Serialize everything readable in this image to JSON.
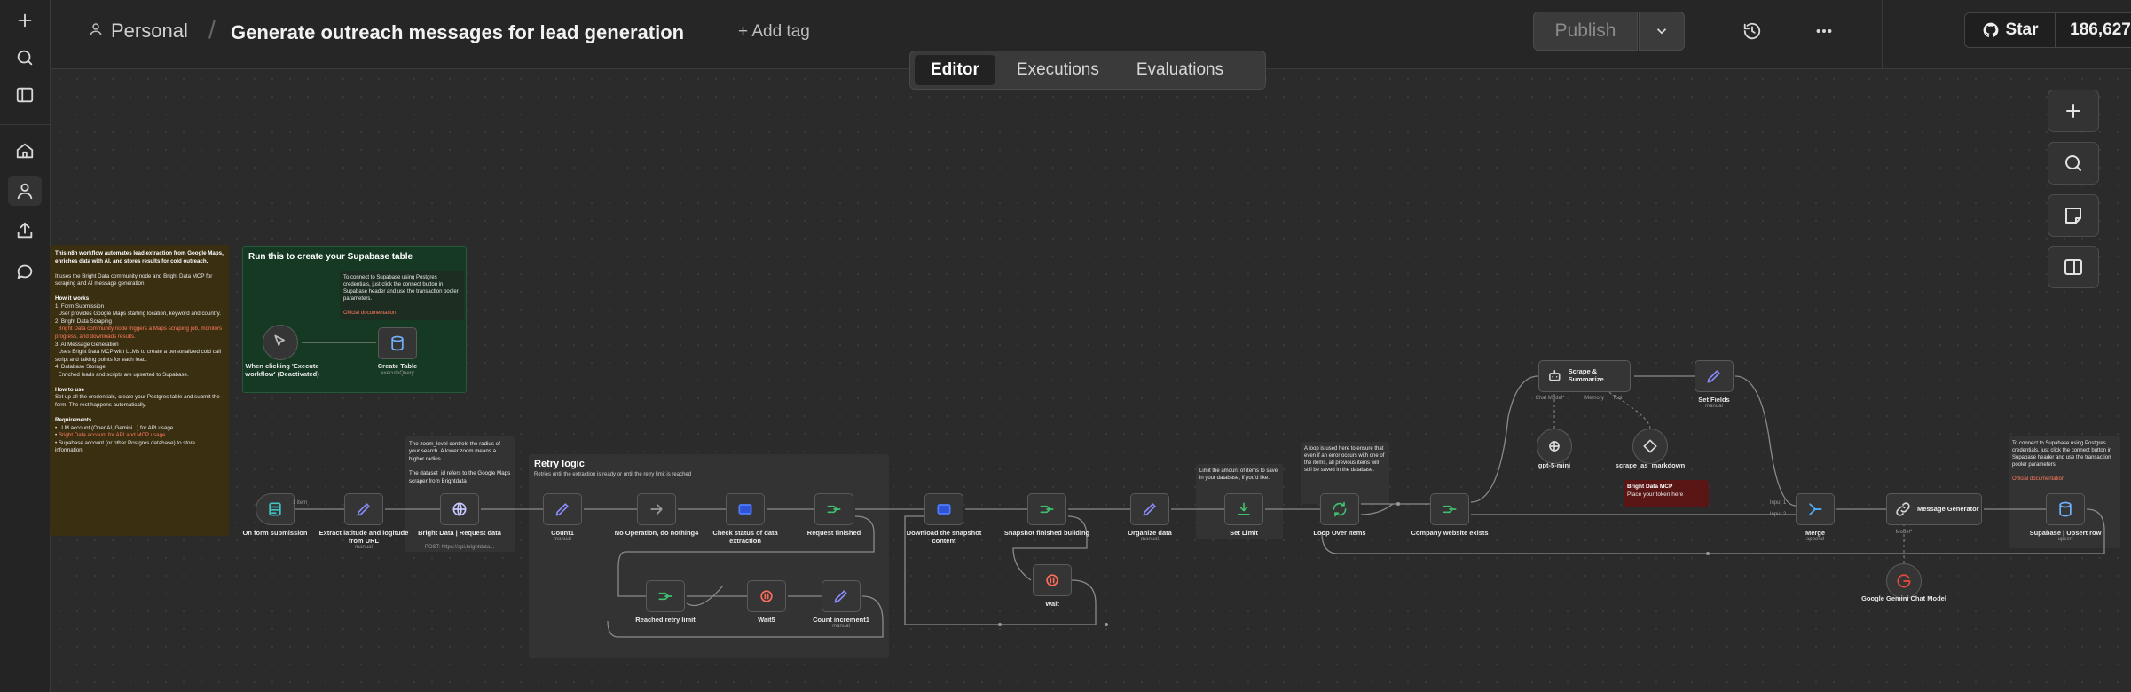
{
  "sidebar": {
    "items": [
      {
        "icon": "plus-icon"
      },
      {
        "icon": "search-icon"
      },
      {
        "icon": "panel-icon"
      },
      {
        "icon": "home-icon"
      },
      {
        "icon": "user-icon"
      },
      {
        "icon": "share-icon"
      },
      {
        "icon": "chat-icon"
      }
    ]
  },
  "header": {
    "project": "Personal",
    "separator": "/",
    "title": "Generate outreach messages for lead generation",
    "add_tag": "+ Add tag",
    "publish": "Publish",
    "star_label": "Star",
    "star_count": "186,627"
  },
  "tabs": [
    {
      "label": "Editor",
      "active": true
    },
    {
      "label": "Executions",
      "active": false
    },
    {
      "label": "Evaluations",
      "active": false
    }
  ],
  "notes": {
    "intro_title": "This n8n workflow automates lead extraction from Google Maps, enriches data with AI, and stores results for cold outreach.",
    "intro_uses": "It uses the Bright Data community node and Bright Data MCP for scraping and AI message generation.",
    "intro_how_head": "How it works",
    "intro_how_1": "1. Form Submission",
    "intro_how_1b": "User provides Google Maps starting location, keyword and country.",
    "intro_how_2": "2. Bright Data Scraping",
    "intro_how_2b": "Bright Data community node triggers a Maps scraping job, monitors progress, and downloads results.",
    "intro_how_3": "3. AI Message Generation",
    "intro_how_3b": "Uses Bright Data MCP with LLMs to create a personalized cold call script and talking points for each lead.",
    "intro_how_4": "4. Database Storage",
    "intro_how_4b": "Enriched leads and scripts are upserted to Supabase.",
    "intro_use_head": "How to use",
    "intro_use": "Set up all the credentials, create your Postgres table and submit the form. The rest happens automatically.",
    "intro_req_head": "Requirements",
    "intro_req_1": "LLM account (OpenAI, Gemini...) for API usage.",
    "intro_req_2": "Bright Data account for API and MCP usage.",
    "intro_req_3": "Supabase account (or other Postgres database) to store information.",
    "supabase_title": "Run this to create your Supabase table",
    "supabase_inner": "To connect to Supabase using Postgres credentials, just click the connect button in Supabase header and use the transaction pooler parameters.",
    "supabase_doc": "Official documentation",
    "radius_a": "The zoom_level controls the radius of your search. A lower zoom means a higher radius.",
    "radius_b": "The dataset_id refers to the Google Maps scraper from Brightdata",
    "retry_title": "Retry logic",
    "retry_sub": "Retries until the extraction is ready or until the retry limit is reached",
    "limit_note": "Limit the amount of items to save in your database, if you'd like.",
    "loop_note": "A loop is used here to ensure that even if an error occurs with one of the items, all previous items will still be saved in the database.",
    "supa2_note": "To connect to Supabase using Postgres credentials, just click the connect button in Supabase header and use the transaction pooler parameters.",
    "supa2_doc": "Official documentation",
    "mcp_title": "Bright Data MCP",
    "mcp_sub": "Place your token here"
  },
  "nodes": {
    "click_trigger": "When clicking 'Execute workflow' (Deactivated)",
    "create_table": "Create Table",
    "create_table_sub": "executeQuery",
    "form": "On form submission",
    "extract": "Extract latitude and logitude from URL",
    "extract_sub": "manual",
    "bright_request": "Bright Data | Request data",
    "bright_request_sub": "POST: https://api.brightdata...",
    "count1": "Count1",
    "count1_sub": "manual",
    "noop": "No Operation, do nothing4",
    "check_status": "Check status of data extraction",
    "request_finished": "Request finished",
    "reached_retry": "Reached retry limit",
    "wait5": "Wait5",
    "count_increment": "Count increment1",
    "count_increment_sub": "manual",
    "download": "Download the snapshot content",
    "snapshot_finished": "Snapshot finished building",
    "wait": "Wait",
    "organize": "Organize data",
    "organize_sub": "manual",
    "set_limit": "Set Limit",
    "loop": "Loop Over Items",
    "company_website": "Company website exists",
    "scrape": "Scrape & Summarize",
    "set_fields": "Set Fields",
    "set_fields_sub": "manual",
    "gpt": "gpt-5-mini",
    "scrape_md": "scrape_as_markdown",
    "merge": "Merge",
    "merge_sub": "append",
    "message_gen": "Message Generator",
    "supabase_upsert": "Supabase | Upsert row",
    "supabase_upsert_sub": "upsert",
    "gemini": "Google Gemini Chat Model",
    "edge_label_1": "1 item",
    "port_chat": "Chat Model*",
    "port_memory": "Memory",
    "port_tool": "Tool",
    "port_input1": "Input 1",
    "port_input2": "Input 2",
    "port_model": "Model*"
  },
  "colors": {
    "accent": "#ff6d5a",
    "intro_note": "#3b2f12",
    "supabase_group": "#153923"
  }
}
